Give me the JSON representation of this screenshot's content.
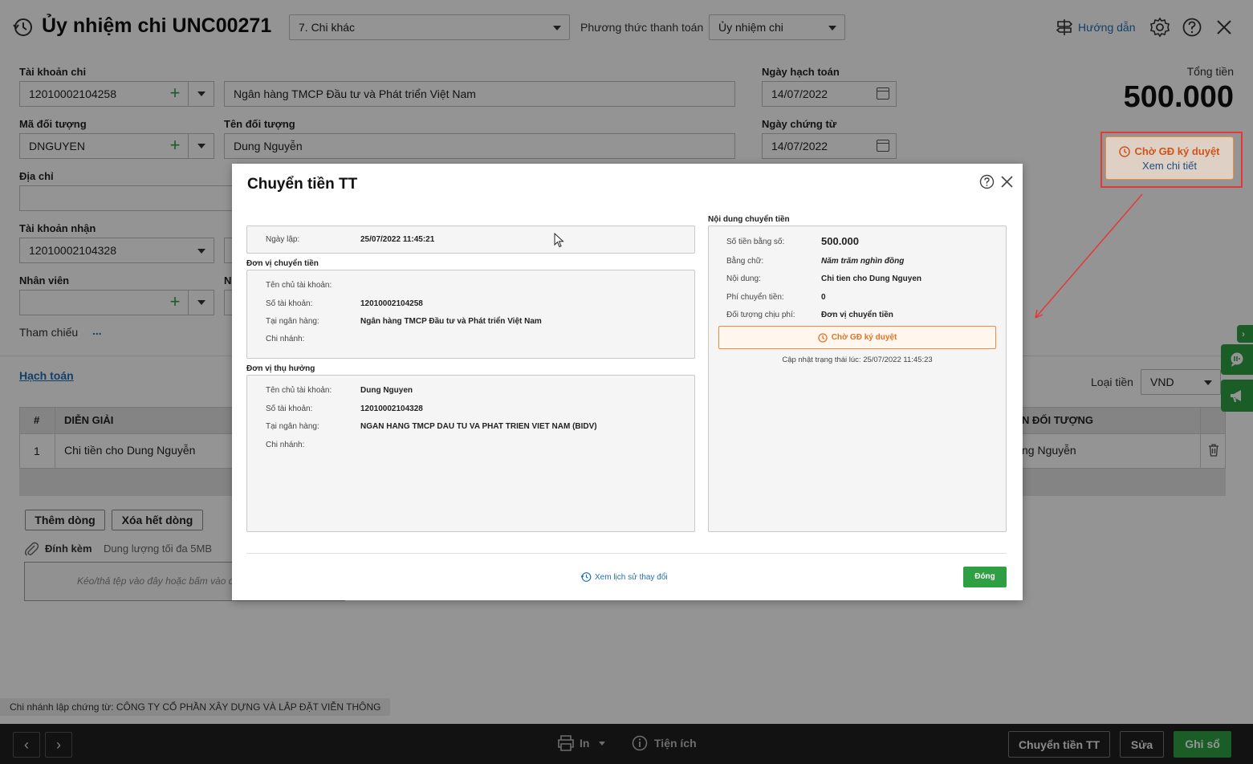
{
  "header": {
    "title": "Ủy nhiệm chi UNC00271",
    "type_select": "7. Chi khác",
    "payment_method_label": "Phương thức thanh toán",
    "payment_method_value": "Ủy nhiệm chi",
    "guide_label": "Hướng dẫn"
  },
  "form": {
    "account_label": "Tài khoản chi",
    "account_value": "12010002104258",
    "bank_name": "Ngân hàng TMCP Đầu tư và Phát triển Việt Nam",
    "object_code_label": "Mã đối tượng",
    "object_code_value": "DNGUYEN",
    "object_name_label": "Tên đối tượng",
    "object_name_value": "Dung Nguyễn",
    "address_label": "Địa chỉ",
    "receive_account_label": "Tài khoản nhận",
    "receive_account_value": "12010002104328",
    "employee_label": "Nhân viên",
    "employee_label2": "N",
    "reference_label": "Tham chiếu",
    "reference_more": "...",
    "posting_date_label": "Ngày hạch toán",
    "posting_date_value": "14/07/2022",
    "voucher_date_label": "Ngày chứng từ",
    "voucher_date_value": "14/07/2022",
    "total_label": "Tổng tiền",
    "total_value": "500.000",
    "status_text": "Chờ GĐ ký duyệt",
    "status_link": "Xem chi tiết"
  },
  "accounting": {
    "tab_label": "Hạch toán",
    "currency_label": "Loại tiền",
    "currency_value": "VND",
    "columns": {
      "num": "#",
      "desc": "DIỄN GIẢI",
      "object": "N ĐỐI TƯỢNG"
    },
    "rows": [
      {
        "num": "1",
        "desc": "Chi tiền cho Dung Nguyễn",
        "object": "ng Nguyễn"
      }
    ],
    "add_row": "Thêm dòng",
    "delete_rows": "Xóa hết dòng",
    "attach_label": "Đính kèm",
    "attach_limit": "Dung lượng tối đa 5MB",
    "drop_hint": "Kéo/thả tệp vào đây hoặc bấm vào đ"
  },
  "branch_note": "Chi nhánh lập chứng từ: CÔNG TY CỔ PHẦN XÂY DỰNG VÀ LẮP ĐẶT VIỄN THÔNG",
  "footer": {
    "print_label": "In",
    "utility_label": "Tiện ích",
    "transfer_button": "Chuyển tiền TT",
    "edit_button": "Sửa",
    "post_button": "Ghi sổ"
  },
  "dialog": {
    "title": "Chuyển tiền TT",
    "created_label": "Ngày lập:",
    "created_value": "25/07/2022 11:45:21",
    "sender_section": "Đơn vị chuyển tiền",
    "sender": {
      "owner_label": "Tên chủ tài khoản:",
      "owner_value": "",
      "account_label": "Số tài khoản:",
      "account_value": "12010002104258",
      "bank_label": "Tại ngân hàng:",
      "bank_value": "Ngân hàng TMCP Đầu tư và Phát triển Việt Nam",
      "branch_label": "Chi nhánh:"
    },
    "receiver_section": "Đơn vị thụ hưởng",
    "receiver": {
      "owner_label": "Tên chủ tài khoản:",
      "owner_value": "Dung Nguyen",
      "account_label": "Số tài khoản:",
      "account_value": "12010002104328",
      "bank_label": "Tại ngân hàng:",
      "bank_value": "NGAN HANG TMCP DAU TU VA PHAT TRIEN VIET NAM (BIDV)",
      "branch_label": "Chi nhánh:"
    },
    "content_section": "Nội dung chuyển tiền",
    "content": {
      "amount_label": "Số tiền bằng số:",
      "amount_value": "500.000",
      "words_label": "Bằng chữ:",
      "words_value": "Năm trăm nghìn đồng",
      "desc_label": "Nội dung:",
      "desc_value": "Chi tien cho Dung Nguyen",
      "fee_label": "Phí chuyển tiền:",
      "fee_value": "0",
      "payer_label": "Đối tượng chịu phí:",
      "payer_value": "Đơn vị chuyển tiền",
      "status": "Chờ GĐ ký duyệt",
      "updated": "Cập nhật trạng thái lúc: 25/07/2022 11:45:23"
    },
    "history_link": "Xem lịch sử thay đổi",
    "close_button": "Đóng"
  },
  "colors": {
    "accent_green": "#2ea043",
    "status_orange": "#f08a3c",
    "annotation_red": "#e53935",
    "link_blue": "#1f6fb5"
  }
}
